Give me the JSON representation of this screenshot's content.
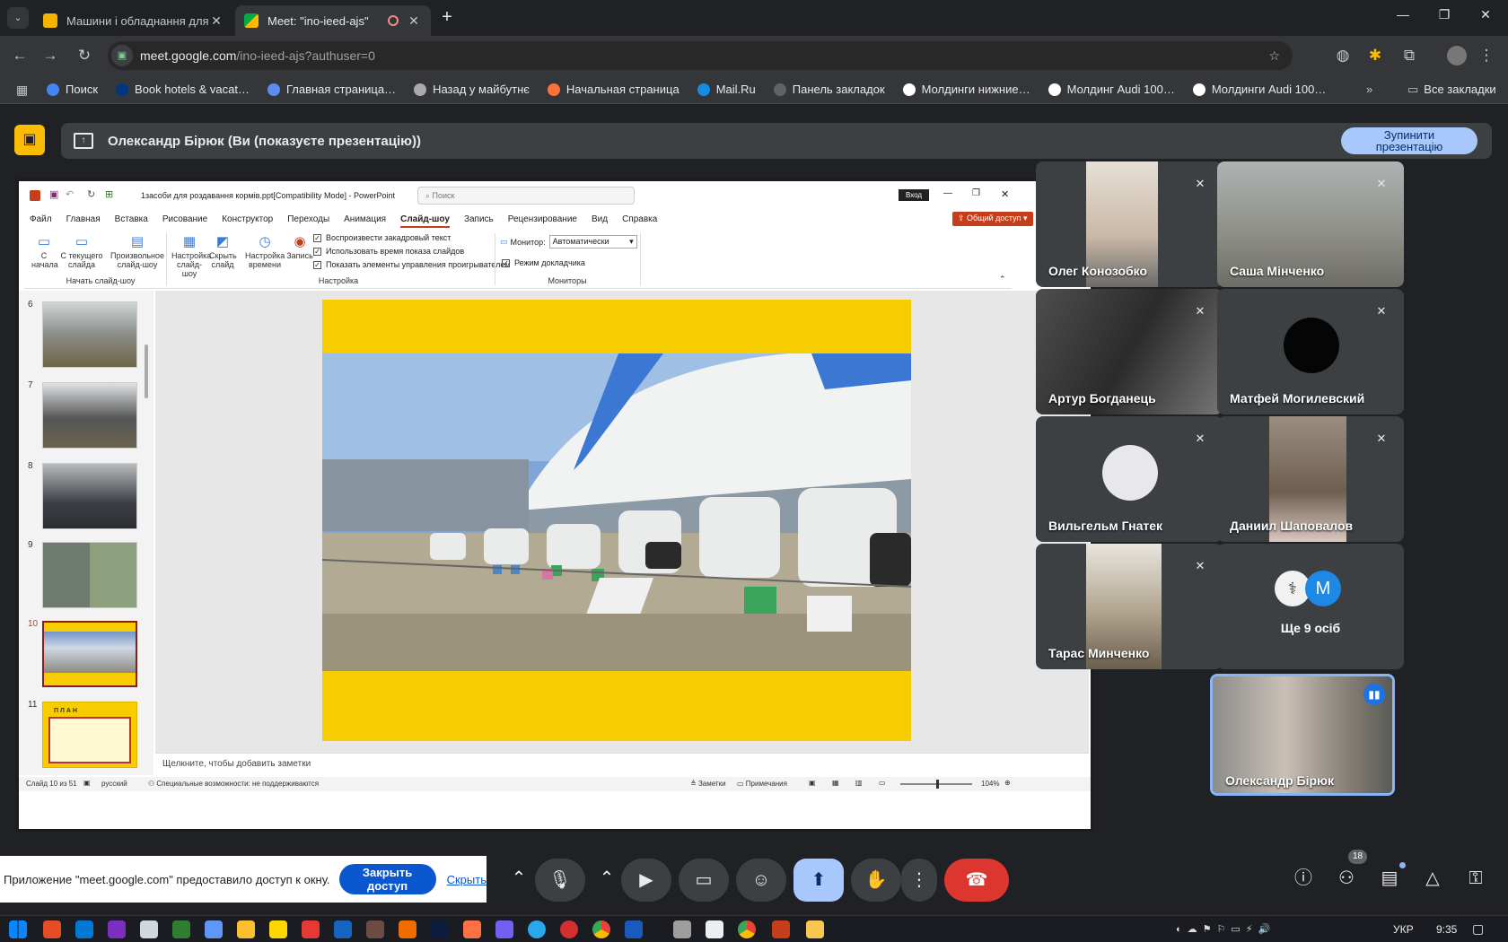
{
  "browser": {
    "tabs": [
      {
        "title": "Машини і обладнання для тва…",
        "favicon_color": "#f4b400",
        "active": false
      },
      {
        "title": "Meet: \"ino-ieed-ajs\"",
        "favicon_color": "#00ac47",
        "active": true
      }
    ],
    "url_host": "meet.google.com",
    "url_path": "/ino-ieed-ajs?authuser=0",
    "bookmarks": [
      {
        "label": "Поиск",
        "icon_color": "#4285f4"
      },
      {
        "label": "Book hotels & vacat…",
        "icon_color": "#003580"
      },
      {
        "label": "Главная страница…",
        "icon_color": "#5a8dee"
      },
      {
        "label": "Назад у майбутнє",
        "icon_color": "#aaaaaa"
      },
      {
        "label": "Начальная страница",
        "icon_color": "#ff7139"
      },
      {
        "label": "Mail.Ru",
        "icon_color": "#168de2"
      },
      {
        "label": "Панель закладок",
        "icon_color": "#5f6368"
      },
      {
        "label": "Молдинги нижние…",
        "icon_color": "#ffffff"
      },
      {
        "label": "Молдинг Audi 100…",
        "icon_color": "#ffffff"
      },
      {
        "label": "Молдинги Audi 100…",
        "icon_color": "#ffffff"
      }
    ],
    "all_bookmarks": "Все закладки"
  },
  "meet": {
    "banner_text": "Олександр Бірюк (Ви (показуєте презентацію))",
    "stop_button": "Зупинити презентацію",
    "participants": [
      {
        "name": "Олег Конозобко"
      },
      {
        "name": "Саша Мінченко"
      },
      {
        "name": "Артур Богданець"
      },
      {
        "name": "Матфей Могилевский"
      },
      {
        "name": "Вильгельм Гнатек"
      },
      {
        "name": "Даниил Шаповалов"
      },
      {
        "name": "Тарас Минченко"
      },
      {
        "name": "Ще 9 осіб",
        "avatar_letter": "M"
      }
    ],
    "self_tile_name": "Олександр Бірюк",
    "people_count": "18",
    "share_notice": "Приложение \"meet.google.com\" предоставило доступ к окну.",
    "stop_access_button": "Закрыть доступ",
    "hide_link": "Скрыть"
  },
  "powerpoint": {
    "title": "1засоби для роздавання кормів.ppt[Compatibility Mode] - PowerPoint",
    "search_placeholder": "Поиск",
    "login": "Вход",
    "share_button": "Общий доступ",
    "ribbon_tabs": [
      "Файл",
      "Главная",
      "Вставка",
      "Рисование",
      "Конструктор",
      "Переходы",
      "Анимация",
      "Слайд-шоу",
      "Запись",
      "Рецензирование",
      "Вид",
      "Справка"
    ],
    "active_tab": "Слайд-шоу",
    "buttons": {
      "from_start": "С начала",
      "from_current": "С текущего слайда",
      "custom": "Произвольное слайд-шоу",
      "setup": "Настройка слайд-шоу",
      "hide": "Скрыть слайд",
      "timing": "Настройка времени",
      "record": "Запись"
    },
    "checkboxes": [
      "Воспроизвести закадровый текст",
      "Использовать время показа слайдов",
      "Показать элементы управления проигрывателем"
    ],
    "monitor_label": "Монитор:",
    "monitor_value": "Автоматически",
    "presenter_mode": "Режим докладчика",
    "groups": [
      "Начать слайд-шоу",
      "Настройка",
      "Мониторы"
    ],
    "slide_numbers": [
      "6",
      "7",
      "8",
      "9",
      "10",
      "11"
    ],
    "thumb11_title": "П Л А Н",
    "notes_placeholder": "Щелкните, чтобы добавить заметки",
    "status": {
      "slide": "Слайд 10 из 51",
      "lang": "русский",
      "accessibility": "Специальные возможности: не поддерживаются",
      "notes": "Заметки",
      "comments": "Примечания",
      "zoom": "104%"
    }
  },
  "taskbar": {
    "lang": "УКР",
    "time": "9:35"
  },
  "colors": {
    "accent_blue": "#a8c7fa",
    "end_call_red": "#dc362e",
    "slide_yellow": "#f7cc00",
    "ppt_red": "#c43e1c"
  }
}
